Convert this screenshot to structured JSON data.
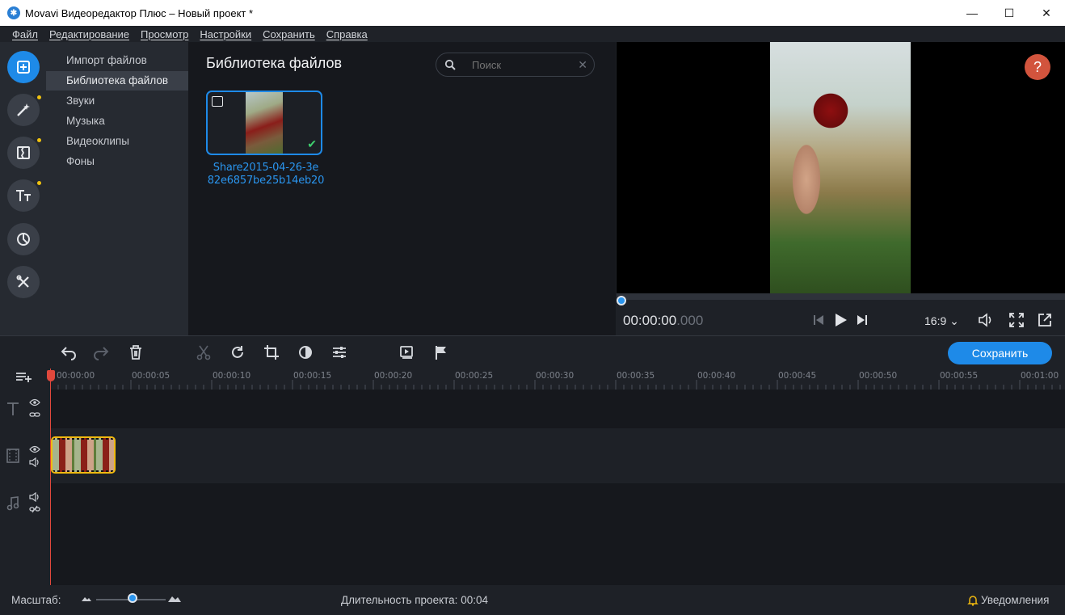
{
  "window": {
    "title": "Movavi Видеоредактор Плюс – Новый проект *",
    "minimize": "—",
    "maximize": "☐",
    "close": "✕"
  },
  "menu": [
    "Файл",
    "Редактирование",
    "Просмотр",
    "Настройки",
    "Сохранить",
    "Справка"
  ],
  "left_tools": [
    {
      "icon": "import-icon",
      "active": true,
      "dot": false
    },
    {
      "icon": "magic-wand-icon",
      "active": false,
      "dot": true
    },
    {
      "icon": "transitions-icon",
      "active": false,
      "dot": true
    },
    {
      "icon": "titles-icon",
      "active": false,
      "dot": true
    },
    {
      "icon": "stickers-icon",
      "active": false,
      "dot": false
    },
    {
      "icon": "tools-icon",
      "active": false,
      "dot": false
    }
  ],
  "categories": [
    "Импорт файлов",
    "Библиотека файлов",
    "Звуки",
    "Музыка",
    "Видеоклипы",
    "Фоны"
  ],
  "selected_category": "Библиотека файлов",
  "library": {
    "title": "Библиотека файлов",
    "search_placeholder": "Поиск",
    "file_name_line1": "Share2015-04-26-3e",
    "file_name_line2": "82e6857be25b14eb20"
  },
  "player": {
    "help": "?",
    "timecode_main": "00:00:00",
    "timecode_ms": ".000",
    "aspect_ratio": "16:9",
    "progress": 0
  },
  "toolbar": {
    "save_label": "Сохранить"
  },
  "ruler_ticks": [
    "00:00:00",
    "00:00:05",
    "00:00:10",
    "00:00:15",
    "00:00:20",
    "00:00:25",
    "00:00:30",
    "00:00:35",
    "00:00:40",
    "00:00:45",
    "00:00:50",
    "00:00:55",
    "00:01:00"
  ],
  "status": {
    "zoom_label": "Масштаб:",
    "zoom_level": 0.52,
    "duration_label": "Длительность проекта:",
    "duration_value": "00:04",
    "notifications": "Уведомления"
  },
  "colors": {
    "accent": "#1e8ae8",
    "clip_border": "#f0b90f",
    "playhead": "#e0483c",
    "help": "#d2543d"
  }
}
